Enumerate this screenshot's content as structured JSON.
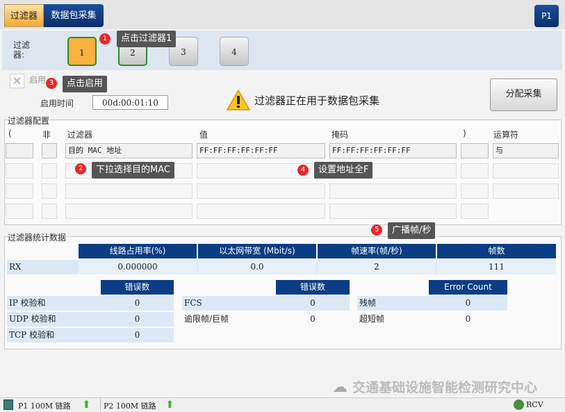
{
  "tabs": [
    {
      "label": "过滤器",
      "active": true
    },
    {
      "label": "数据包采集"
    }
  ],
  "port_button": "P1",
  "filter_selector": {
    "label": "过滤器:",
    "buttons": [
      "1",
      "2",
      "3",
      "4"
    ],
    "selected": "1"
  },
  "enable": {
    "label": "启用",
    "checked": false
  },
  "enable_time": {
    "label": "启用时间",
    "value": "00d:00:01:10"
  },
  "warning": {
    "icon": "warning-icon",
    "text": "过滤器正在用于数据包采集"
  },
  "assign_button": "分配采集",
  "config": {
    "title": "过滤器配置",
    "headers": [
      "(",
      "非",
      "过滤器",
      "值",
      "掩码",
      ")",
      "运算符"
    ],
    "rows": [
      {
        "filter": "目的 MAC 地址",
        "value": "FF:FF:FF:FF:FF:FF",
        "mask": "FF:FF:FF:FF:FF:FF",
        "op": "与"
      },
      {},
      {},
      {}
    ]
  },
  "stats": {
    "title": "过滤器统计数据",
    "headers": [
      "线路占用率(%)",
      "以太网带宽 (Mbit/s)",
      "帧速率(帧/秒)",
      "帧数"
    ],
    "rx": {
      "label": "RX",
      "values": [
        "0.000000",
        "0.0",
        "2",
        "111"
      ]
    },
    "err1": {
      "header": "错误数",
      "rows": [
        [
          "IP 校验和",
          "0"
        ],
        [
          "UDP 校验和",
          "0"
        ],
        [
          "TCP 校验和",
          "0"
        ]
      ]
    },
    "err2": {
      "header": "错误数",
      "rows": [
        [
          "FCS",
          "0"
        ],
        [
          "逾限帧/巨帧",
          "0"
        ]
      ]
    },
    "err3": {
      "header": "Error Count",
      "rows": [
        [
          "残帧",
          "0"
        ],
        [
          "超短帧",
          "0"
        ]
      ]
    }
  },
  "annotations": [
    {
      "n": "1",
      "text": "点击过滤器1"
    },
    {
      "n": "2",
      "text": "下拉选择目的MAC"
    },
    {
      "n": "3",
      "text": "点击启用"
    },
    {
      "n": "4",
      "text": "设置地址全F"
    },
    {
      "n": "5",
      "text": "广播帧/秒"
    }
  ],
  "watermark": "交通基础设施智能检测研究中心",
  "status": {
    "p1": "P1 100M  链路",
    "p2": "P2 100M  链路",
    "rcv": "RCV"
  },
  "colors": {
    "accent": "#0b3d84",
    "selected": "#f9b240",
    "callout": "#555555"
  }
}
